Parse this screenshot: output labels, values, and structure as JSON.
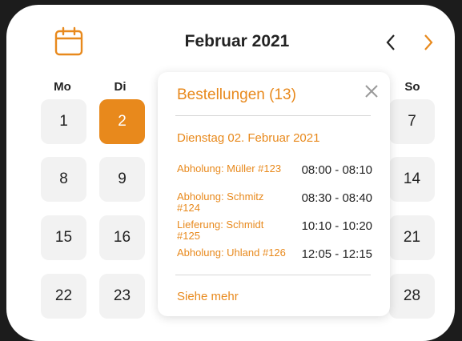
{
  "calendar": {
    "month_title": "Februar 2021",
    "prev_icon": "chevron-left-icon",
    "next_icon": "chevron-right-icon",
    "calendar_icon": "calendar-icon",
    "accent_color": "#e8891c",
    "weekdays": [
      "Mo",
      "Di",
      "So"
    ],
    "days": [
      "1",
      "2",
      "7",
      "8",
      "9",
      "14",
      "15",
      "16",
      "21",
      "22",
      "23",
      "28"
    ],
    "selected_day": "2"
  },
  "popup": {
    "title": "Bestellungen (13)",
    "close_icon": "close-icon",
    "date": "Dienstag 02. Februar 2021",
    "orders": [
      {
        "label": "Abholung: Müller #123",
        "time": "08:00 - 08:10"
      },
      {
        "label": "Abholung: Schmitz #124",
        "time": "08:30 - 08:40"
      },
      {
        "label": "Lieferung: Schmidt #125",
        "time": "10:10 - 10:20"
      },
      {
        "label": "Abholung: Uhland #126",
        "time": "12:05 - 12:15"
      }
    ],
    "more": "Siehe mehr"
  }
}
